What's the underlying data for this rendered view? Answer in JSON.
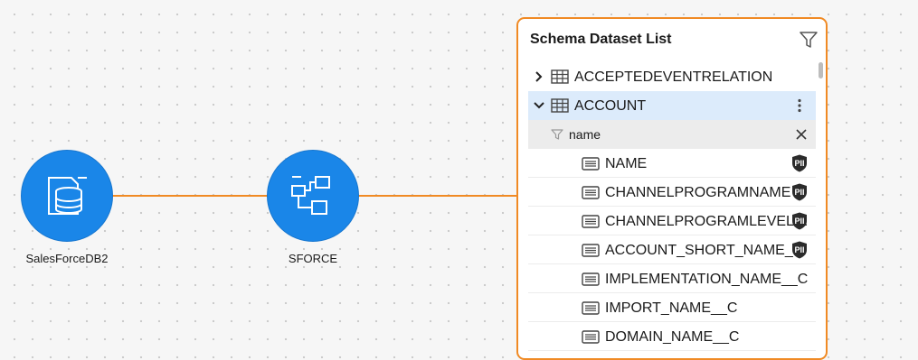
{
  "canvas": {
    "nodes": [
      {
        "label": "SalesForceDB2",
        "icon": "database-icon"
      },
      {
        "label": "SFORCE",
        "icon": "schema-icon"
      }
    ],
    "accent_color": "#1a86e8",
    "edge_color": "#f08a24"
  },
  "panel": {
    "title": "Schema Dataset List",
    "tables": [
      {
        "name": "ACCEPTEDEVENTRELATION",
        "expanded": false
      },
      {
        "name": "ACCOUNT",
        "expanded": true
      }
    ],
    "search": {
      "value": "name"
    },
    "columns": [
      {
        "name": "NAME",
        "pii": true
      },
      {
        "name": "CHANNELPROGRAMNAME",
        "pii": true
      },
      {
        "name": "CHANNELPROGRAMLEVEL…",
        "pii": true
      },
      {
        "name": "ACCOUNT_SHORT_NAME_…",
        "pii": true
      },
      {
        "name": "IMPLEMENTATION_NAME__C",
        "pii": false
      },
      {
        "name": "IMPORT_NAME__C",
        "pii": false
      },
      {
        "name": "DOMAIN_NAME__C",
        "pii": false
      }
    ],
    "pii_label": "PII"
  }
}
